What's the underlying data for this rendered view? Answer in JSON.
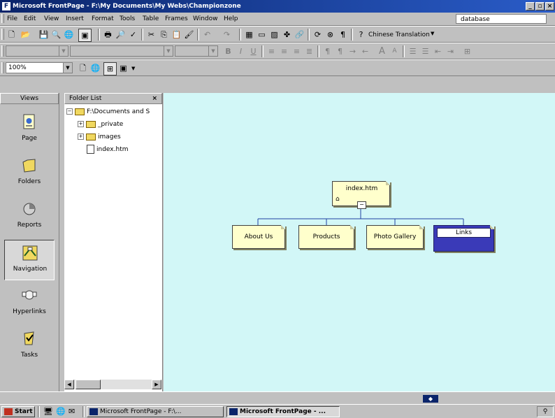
{
  "window": {
    "title": "Microsoft FrontPage - F:\\My Documents\\My Webs\\Championzone"
  },
  "menu": {
    "items": [
      {
        "label": "File"
      },
      {
        "label": "Edit"
      },
      {
        "label": "View"
      },
      {
        "label": "Insert"
      },
      {
        "label": "Format"
      },
      {
        "label": "Tools"
      },
      {
        "label": "Table"
      },
      {
        "label": "Frames"
      },
      {
        "label": "Window"
      },
      {
        "label": "Help"
      }
    ],
    "ask_box": "database"
  },
  "toolbar": {
    "translation_label": "Chinese Translation",
    "zoom_value": "100%"
  },
  "views": {
    "header": "Views",
    "items": [
      {
        "label": "Page"
      },
      {
        "label": "Folders"
      },
      {
        "label": "Reports"
      },
      {
        "label": "Navigation"
      },
      {
        "label": "Hyperlinks"
      },
      {
        "label": "Tasks"
      }
    ]
  },
  "folder_list": {
    "header": "Folder List",
    "close": "×",
    "root": "F:\\Documents and S",
    "children": [
      {
        "label": "_private"
      },
      {
        "label": "images"
      },
      {
        "label": "index.htm"
      }
    ]
  },
  "navigation": {
    "root_page": "index.htm",
    "children": [
      {
        "label": "About Us"
      },
      {
        "label": "Products"
      },
      {
        "label": "Photo Gallery"
      },
      {
        "label": "Links"
      }
    ],
    "selected": "Links"
  },
  "taskbar": {
    "start": "Start",
    "tasks": [
      {
        "label": "Microsoft FrontPage - F:\\..."
      },
      {
        "label": "Microsoft FrontPage - ..."
      }
    ]
  },
  "colors": {
    "title_bar": "#0a246a",
    "nav_background": "#d2f7f7",
    "page_box": "#ffffcc",
    "selected_page": "#3a3ab8"
  }
}
